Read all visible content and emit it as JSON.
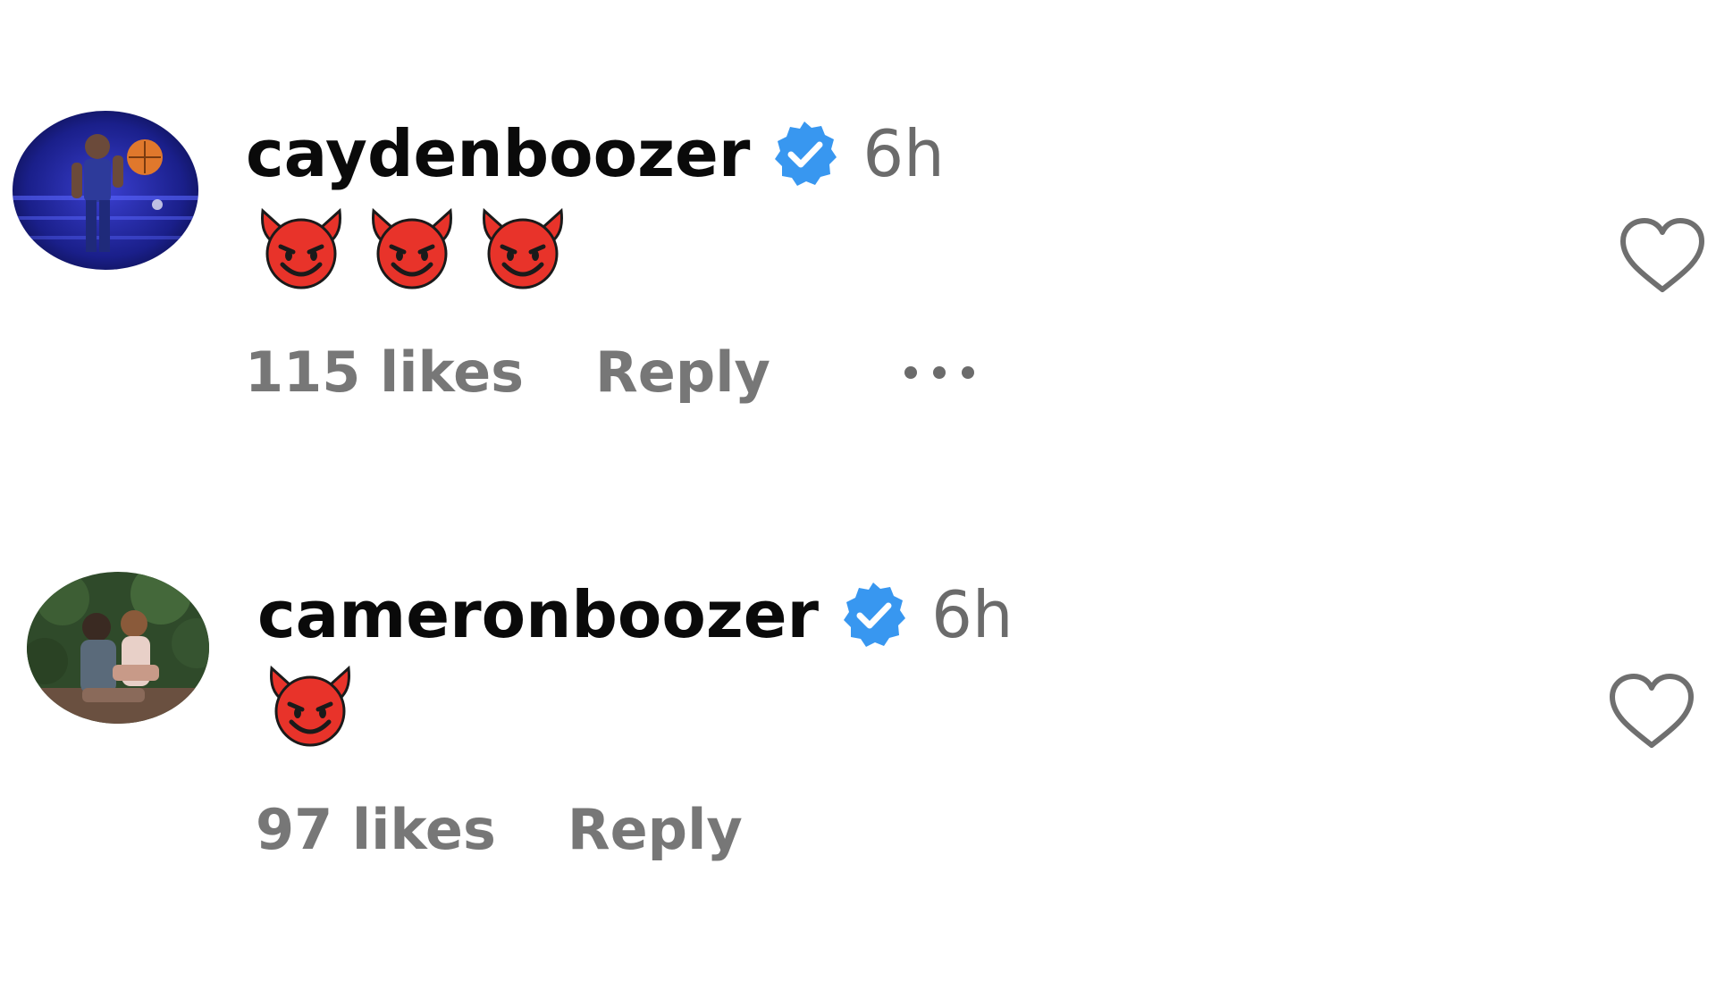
{
  "comments": [
    {
      "username": "caydenboozer",
      "verified": true,
      "time": "6h",
      "emoji_name": "smiling-face-with-horns",
      "emoji_count": 3,
      "likes": "115 likes",
      "reply": "Reply",
      "has_more_menu": true
    },
    {
      "username": "cameronboozer",
      "verified": true,
      "time": "6h",
      "emoji_name": "smiling-face-with-horns",
      "emoji_count": 1,
      "likes": "97 likes",
      "reply": "Reply",
      "has_more_menu": false
    }
  ],
  "colors": {
    "verified_badge": "#3897f0",
    "emoji_red": "#e8332a",
    "muted_text": "#777777"
  }
}
